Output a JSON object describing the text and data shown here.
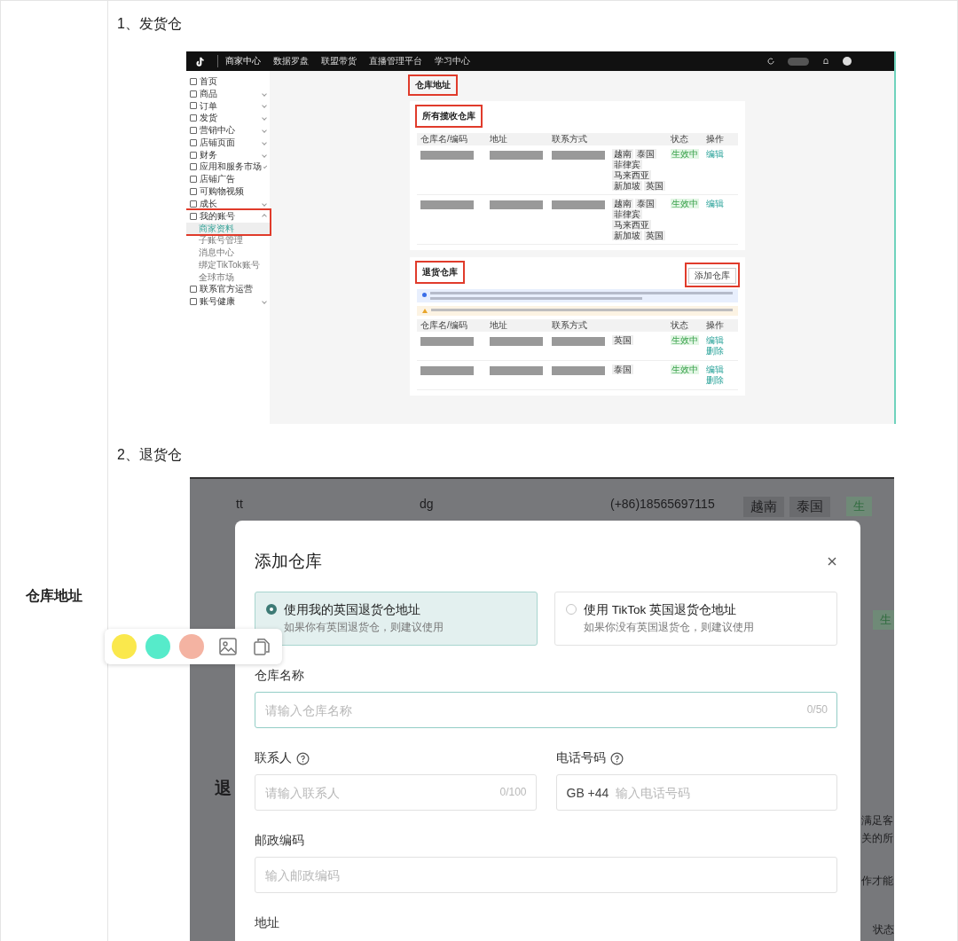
{
  "label_cell": "仓库地址",
  "sections": [
    {
      "heading": "1、发货仓"
    },
    {
      "heading": "2、退货仓"
    }
  ],
  "shipping_shot": {
    "brand": "商家中心",
    "nav": [
      "数据罗盘",
      "联盟带货",
      "直播管理平台",
      "学习中心"
    ],
    "sidebar": [
      {
        "label": "首页"
      },
      {
        "label": "商品",
        "expanded": false
      },
      {
        "label": "订单",
        "expanded": false
      },
      {
        "label": "发货",
        "expanded": false
      },
      {
        "label": "营销中心",
        "expanded": false
      },
      {
        "label": "店铺页面",
        "expanded": false
      },
      {
        "label": "财务",
        "expanded": false
      },
      {
        "label": "应用和服务市场",
        "expanded": false
      },
      {
        "label": "店铺广告"
      },
      {
        "label": "可购物视频"
      },
      {
        "label": "成长",
        "expanded": false
      },
      {
        "label": "我的账号",
        "expanded": true,
        "highlighted": true,
        "children": [
          {
            "label": "商家资料",
            "selected": true
          },
          {
            "label": "子账号管理",
            "selected": false
          },
          {
            "label": "消息中心",
            "selected": false
          },
          {
            "label": "绑定TikTok账号",
            "selected": false
          },
          {
            "label": "全球市场",
            "selected": false
          }
        ]
      },
      {
        "label": "联系官方运营"
      },
      {
        "label": "账号健康",
        "expanded": false
      }
    ],
    "page_title": {
      "text": "仓库地址",
      "highlighted": true
    },
    "pickup": {
      "title": "所有揽收仓库",
      "highlighted": true,
      "columns": [
        "仓库名/编码",
        "地址",
        "联系方式",
        "状态",
        "操作"
      ],
      "rows": [
        {
          "regions": [
            "越南",
            "泰国",
            "菲律宾",
            "马来西亚",
            "新加坡",
            "英国"
          ],
          "status": "生效中",
          "actions": [
            "编辑"
          ]
        },
        {
          "regions": [
            "越南",
            "泰国",
            "菲律宾",
            "马来西亚",
            "新加坡",
            "英国"
          ],
          "status": "生效中",
          "actions": [
            "编辑"
          ]
        }
      ]
    },
    "returns": {
      "title": "退货仓库",
      "highlighted": true,
      "add_button": {
        "label": "添加仓库",
        "highlighted": true
      },
      "columns": [
        "仓库名/编码",
        "地址",
        "联系方式",
        "状态",
        "操作"
      ],
      "rows": [
        {
          "regions": [
            "英国"
          ],
          "status": "生效中",
          "actions": [
            "编辑",
            "删除"
          ]
        },
        {
          "regions": [
            "泰国"
          ],
          "status": "生效中",
          "actions": [
            "编辑",
            "删除"
          ]
        }
      ]
    }
  },
  "return_shot": {
    "background": {
      "row": {
        "name": "tt",
        "address": "dg",
        "phone": "(+86)18565697115",
        "regions": [
          "越南",
          "泰国"
        ],
        "status": "生"
      },
      "status_2": "生",
      "section_heading": "退",
      "banner": [
        "满足客",
        "关的所"
      ],
      "warning": "作才能",
      "column": "状态"
    },
    "modal": {
      "title": "添加仓库",
      "options": [
        {
          "title": "使用我的英国退货仓地址",
          "hint": "如果你有英国退货仓，则建议使用",
          "selected": true
        },
        {
          "title": "使用 TikTok 英国退货仓地址",
          "hint": "如果你没有英国退货仓，则建议使用",
          "selected": false
        }
      ],
      "field_rows": [
        [
          {
            "kind": "text",
            "label": "仓库名称",
            "placeholder": "请输入仓库名称",
            "counter": "0/50",
            "focused": true
          }
        ],
        [
          {
            "kind": "text",
            "label": "联系人",
            "placeholder": "请输入联系人",
            "counter": "0/100",
            "focused": false,
            "help": true
          },
          {
            "kind": "phone",
            "label": "电话号码",
            "prefix": "GB +44",
            "placeholder": "输入电话号码",
            "focused": false,
            "help": true
          }
        ],
        [
          {
            "kind": "text",
            "label": "邮政编码",
            "placeholder": "输入邮政编码",
            "focused": false
          }
        ],
        [
          {
            "kind": "label",
            "label": "地址"
          }
        ]
      ]
    }
  },
  "floating_toolbar": {
    "swatches": [
      {
        "color": "#fae84c"
      },
      {
        "color": "#56ebca"
      },
      {
        "color": "#f4b3a2"
      }
    ]
  }
}
